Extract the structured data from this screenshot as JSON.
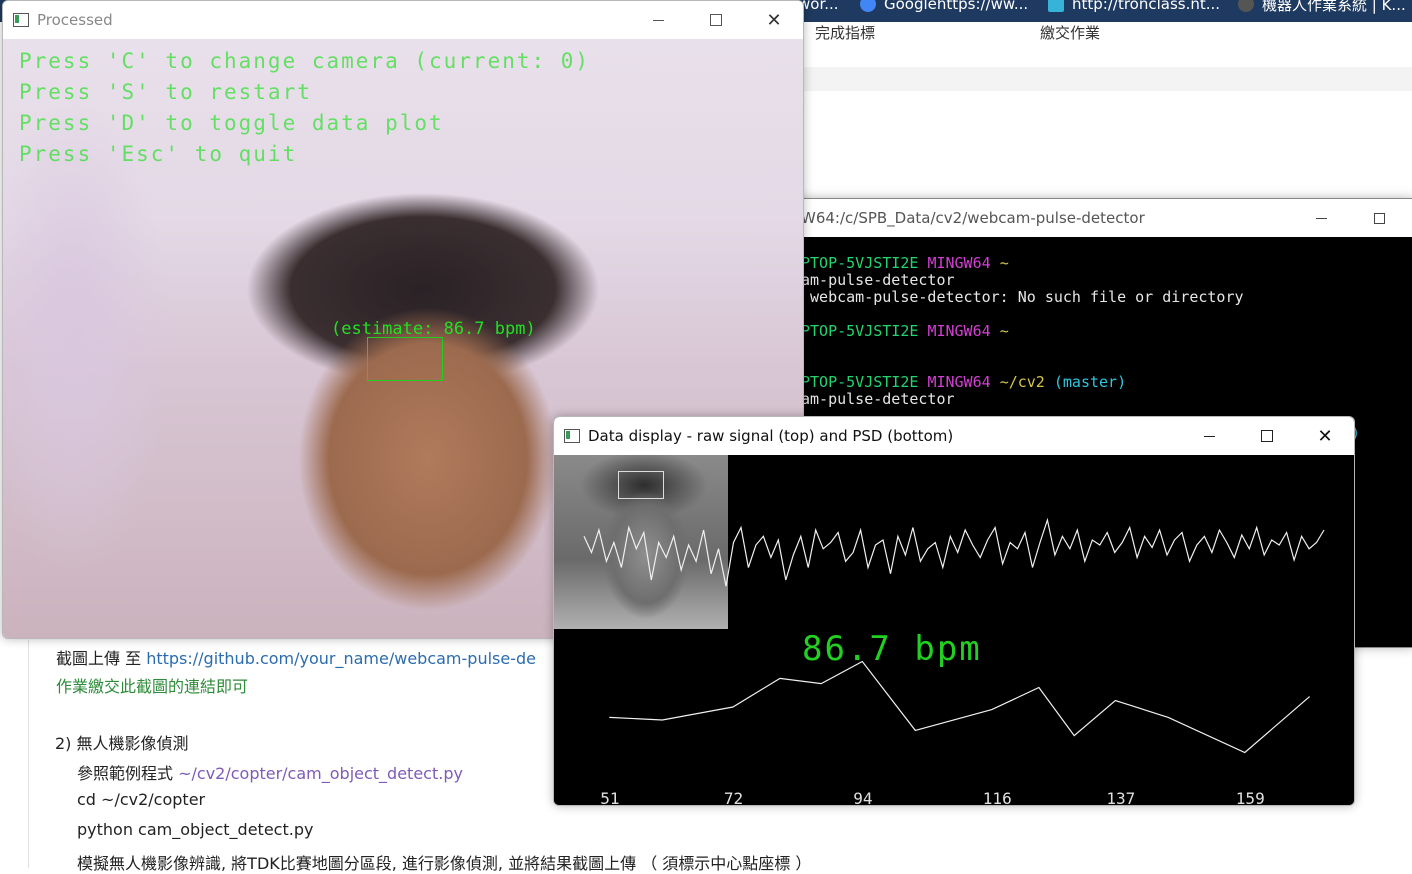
{
  "browser": {
    "tabs": [
      {
        "label": "wor...",
        "color": "#6b7b8c"
      },
      {
        "label": "Googlehttps://ww...",
        "color": "#4285f4"
      },
      {
        "label": "http://tronclass.nt...",
        "color": "#36b3d9"
      },
      {
        "label": "機器人作業系統 | K...",
        "color": "#555555"
      }
    ],
    "nav": {
      "complete_indicator": "完成指標",
      "submit_homework": "繳交作業"
    }
  },
  "document": {
    "upload_prefix": "截圖上傳 至 ",
    "upload_link": "https://github.com/your_name/webcam-pulse-de",
    "submit_note": "作業繳交此截圖的連結即可",
    "section2_title": "2) 無人機影像偵測",
    "ref_prefix": "參照範例程式 ",
    "ref_path": "~/cv2/copter/cam_object_detect.py",
    "cmd_cd": "cd ~/cv2/copter",
    "cmd_python": "python cam_object_detect.py",
    "task_desc": "模擬無人機影像辨識, 將TDK比賽地圖分區段, 進行影像偵測, 並將結果截圖上傳 （ 須標示中心點座標 ）"
  },
  "processed_window": {
    "title": "Processed",
    "hud": [
      "Press 'C' to change camera (current: 0)",
      "Press 'S' to restart",
      "Press 'D' to toggle data plot",
      "Press 'Esc' to quit"
    ],
    "estimate": "(estimate: 86.7 bpm)"
  },
  "terminal_window": {
    "title": "W64:/c/SPB_Data/cv2/webcam-pulse-detector",
    "lines": [
      {
        "host": "PTOP-5VJSTI2E",
        "env": "MINGW64",
        "path": "~",
        "branch": ""
      },
      {
        "text": "am-pulse-detector"
      },
      {
        "text": " webcam-pulse-detector: No such file or directory"
      },
      {
        "host": "PTOP-5VJSTI2E",
        "env": "MINGW64",
        "path": "~",
        "branch": ""
      },
      {
        "host": "PTOP-5VJSTI2E",
        "env": "MINGW64",
        "path": "~/cv2",
        "branch": "(master)"
      },
      {
        "text": "am-pulse-detector"
      }
    ],
    "partial_paren": ")"
  },
  "data_window": {
    "title": "Data display - raw signal (top) and PSD (bottom)",
    "bpm_text": "86.7 bpm",
    "raw_signal": [
      0.55,
      0.42,
      0.6,
      0.35,
      0.5,
      0.3,
      0.62,
      0.45,
      0.58,
      0.2,
      0.5,
      0.38,
      0.55,
      0.28,
      0.48,
      0.35,
      0.6,
      0.25,
      0.45,
      0.15,
      0.5,
      0.62,
      0.3,
      0.48,
      0.55,
      0.38,
      0.52,
      0.2,
      0.4,
      0.55,
      0.3,
      0.6,
      0.45,
      0.5,
      0.58,
      0.35,
      0.42,
      0.6,
      0.3,
      0.48,
      0.52,
      0.25,
      0.55,
      0.4,
      0.62,
      0.35,
      0.45,
      0.5,
      0.3,
      0.55,
      0.42,
      0.6,
      0.48,
      0.38,
      0.52,
      0.62,
      0.33,
      0.5,
      0.45,
      0.58,
      0.3,
      0.5,
      0.68,
      0.4,
      0.55,
      0.45,
      0.6,
      0.35,
      0.52,
      0.48,
      0.58,
      0.42,
      0.5,
      0.62,
      0.38,
      0.55,
      0.46,
      0.6,
      0.4,
      0.52,
      0.58,
      0.35,
      0.48,
      0.55,
      0.42,
      0.6,
      0.5,
      0.38,
      0.56,
      0.45,
      0.62,
      0.4,
      0.52,
      0.48,
      0.58,
      0.36,
      0.55,
      0.45,
      0.5,
      0.6
    ],
    "psd": {
      "x": [
        51,
        60,
        72,
        80,
        87,
        94,
        103,
        116,
        124,
        130,
        137,
        146,
        159,
        170
      ],
      "y": [
        0.52,
        0.5,
        0.6,
        0.82,
        0.78,
        0.95,
        0.42,
        0.58,
        0.75,
        0.38,
        0.65,
        0.52,
        0.25,
        0.68
      ],
      "ticks": [
        51,
        72,
        94,
        116,
        137,
        159
      ]
    }
  }
}
